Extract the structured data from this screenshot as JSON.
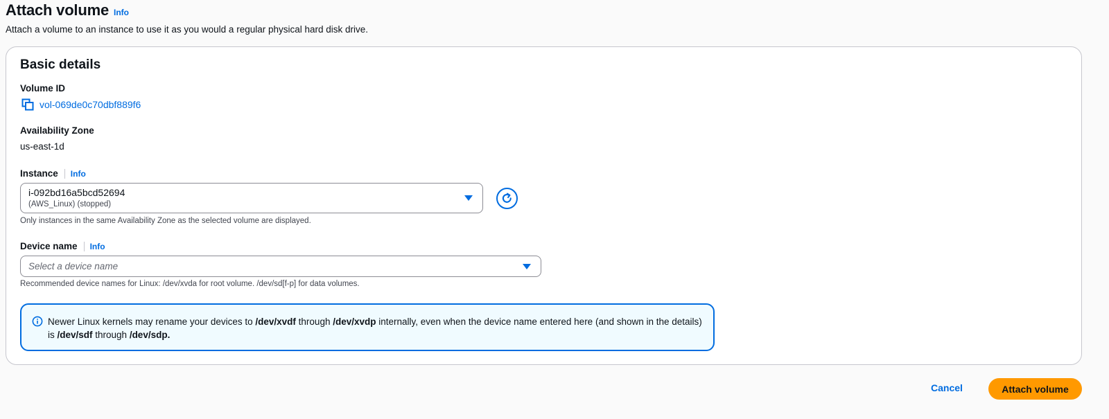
{
  "header": {
    "title": "Attach volume",
    "info_label": "Info",
    "description": "Attach a volume to an instance to use it as you would a regular physical hard disk drive."
  },
  "card": {
    "title": "Basic details",
    "volume_id": {
      "label": "Volume ID",
      "value": "vol-069de0c70dbf889f6",
      "icon": "copy-icon"
    },
    "availability_zone": {
      "label": "Availability Zone",
      "value": "us-east-1d"
    },
    "instance": {
      "label": "Instance",
      "info_label": "Info",
      "selected_id": "i-092bd16a5bcd52694",
      "selected_detail": "(AWS_Linux) (stopped)",
      "hint": "Only instances in the same Availability Zone as the selected volume are displayed.",
      "refresh_icon": "refresh-icon"
    },
    "device_name": {
      "label": "Device name",
      "info_label": "Info",
      "placeholder": "Select a device name",
      "hint": "Recommended device names for Linux: /dev/xvda for root volume. /dev/sd[f-p] for data volumes."
    },
    "alert": {
      "icon": "info-circle-icon",
      "part1": "Newer Linux kernels may rename your devices to ",
      "bold1": "/dev/xvdf",
      "part2": " through ",
      "bold2": "/dev/xvdp",
      "part3": " internally, even when the device name entered here (and shown in the details) is ",
      "bold3": "/dev/sdf",
      "part4": " through ",
      "bold4": "/dev/sdp."
    }
  },
  "footer": {
    "cancel_label": "Cancel",
    "attach_label": "Attach volume"
  },
  "colors": {
    "link": "#006ce0",
    "primary_button": "#ff9900",
    "alert_bg": "#f0fbff",
    "alert_border": "#006ce0",
    "card_border": "#c6c6cd"
  }
}
